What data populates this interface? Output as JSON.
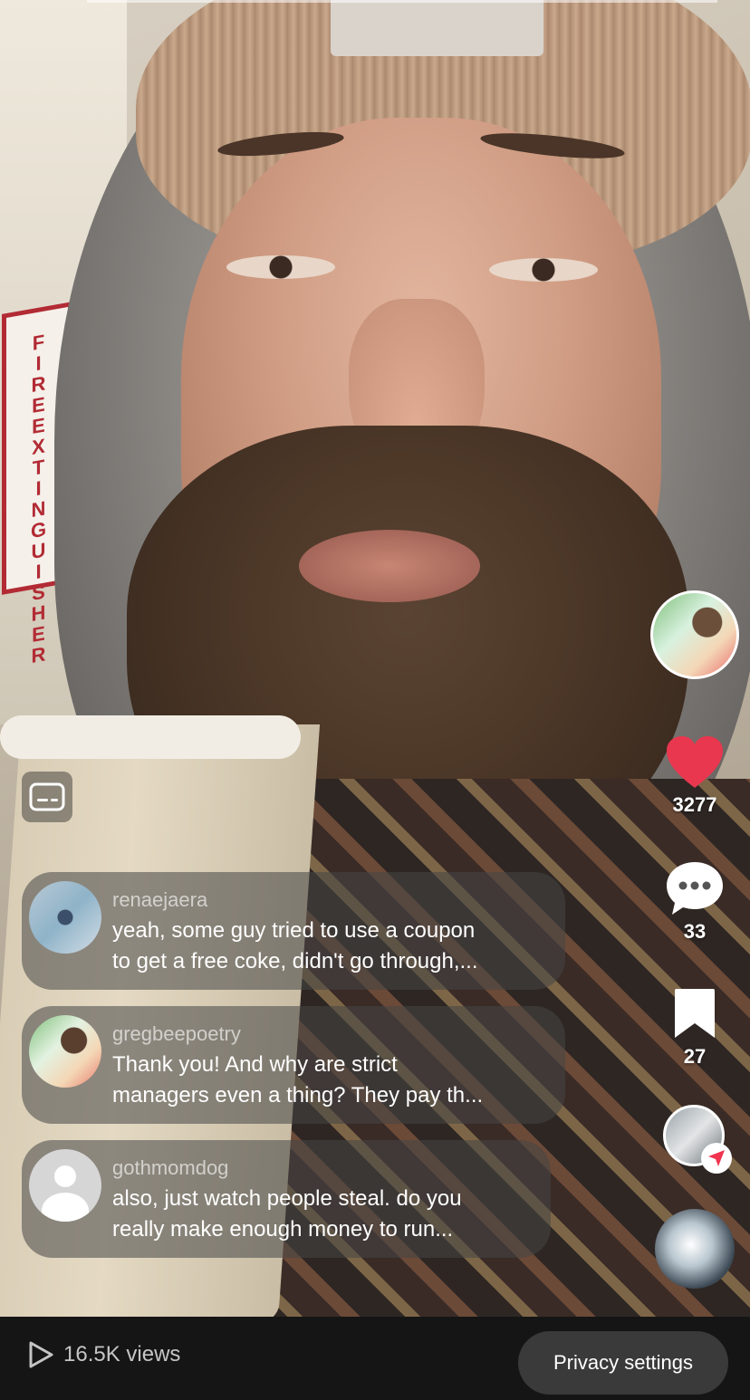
{
  "video": {
    "background_sign_text": "FIRE EXTINGUISHER"
  },
  "actions": {
    "like_count": "3277",
    "comment_count": "33",
    "save_count": "27",
    "like_color": "#e8374f"
  },
  "comments": [
    {
      "username": "renaejaera",
      "text": "yeah, some guy tried to use a coupon\nto get a free coke, didn't go through,..."
    },
    {
      "username": "gregbeepoetry",
      "text": "Thank you! And why are strict\nmanagers even a thing? They pay th..."
    },
    {
      "username": "gothmomdog",
      "text": "also, just watch people steal. do you\nreally make enough money to run..."
    }
  ],
  "footer": {
    "views": "16.5K views",
    "privacy_label": "Privacy settings"
  }
}
